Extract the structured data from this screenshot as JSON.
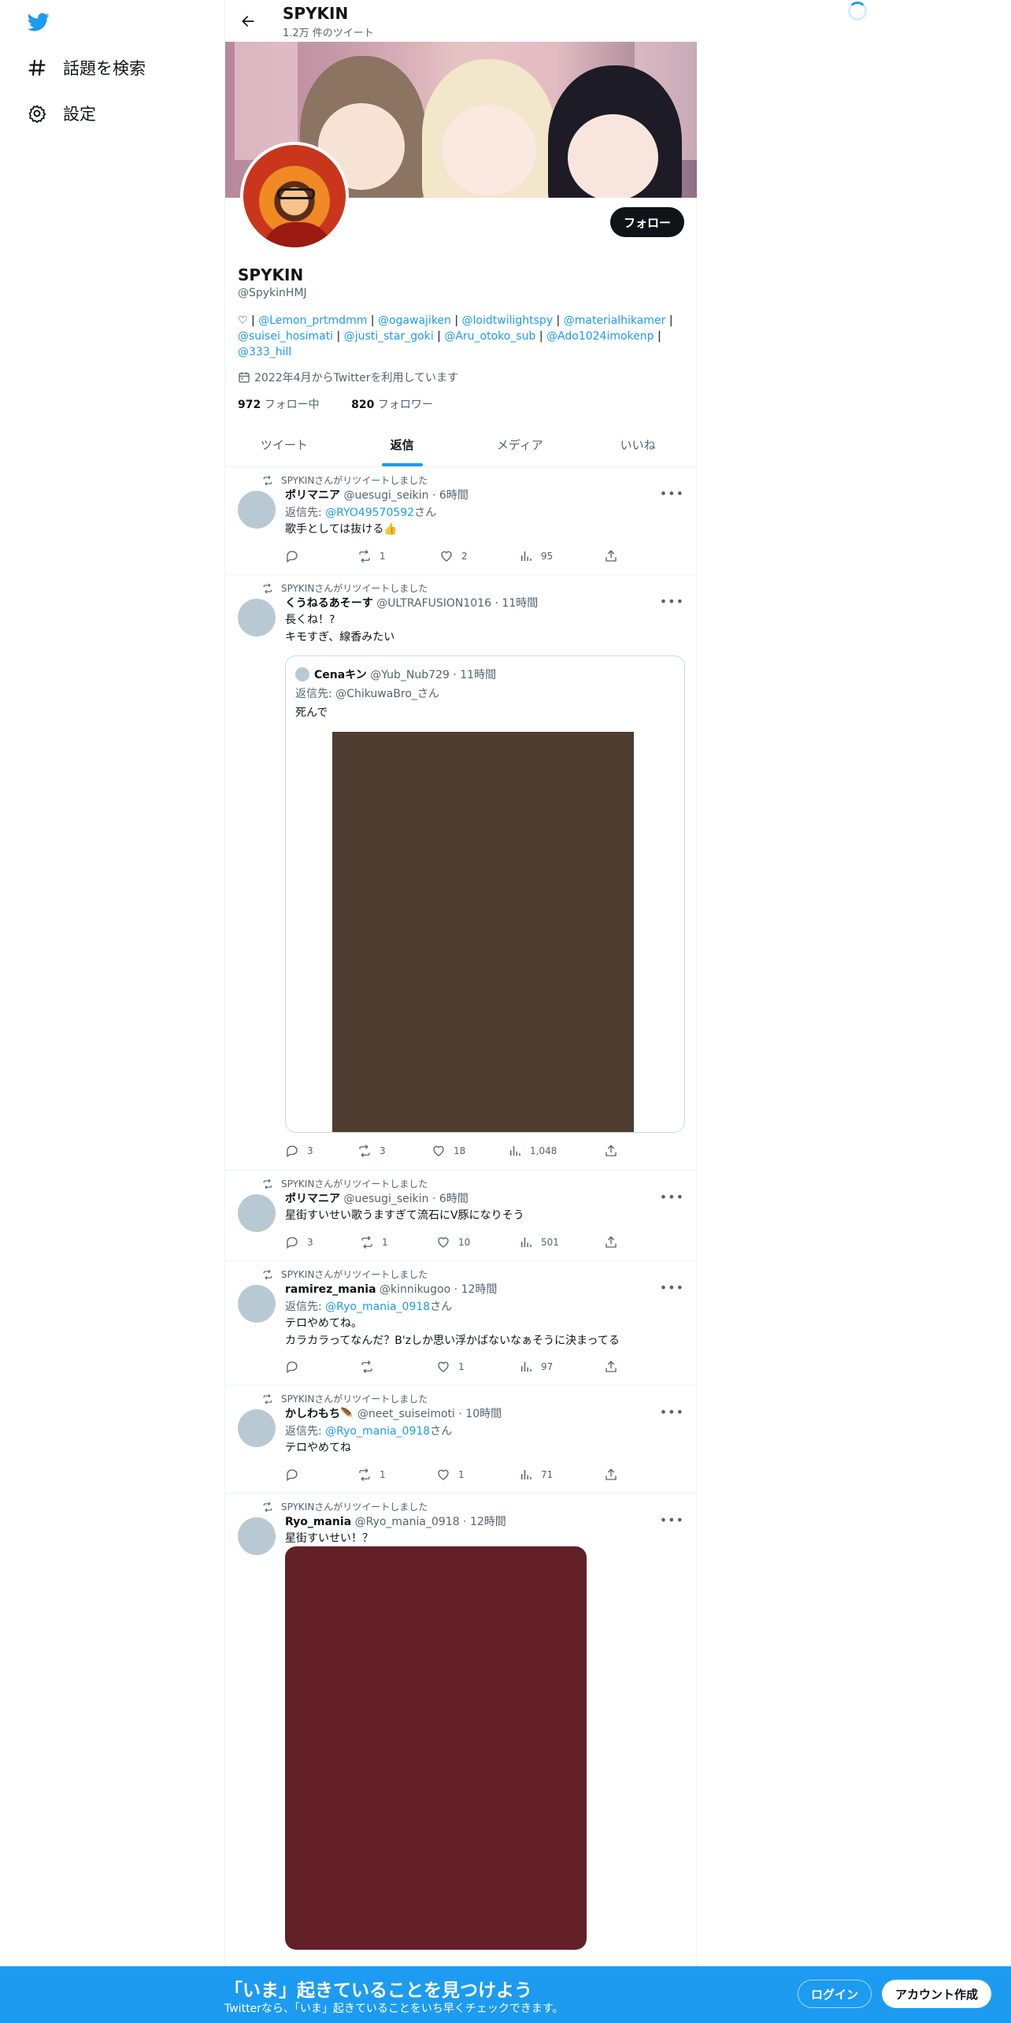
{
  "nav": {
    "explore_label": "話題を検索",
    "settings_label": "設定"
  },
  "header": {
    "title": "SPYKIN",
    "subtitle": "1.2万 件のツイート"
  },
  "profile": {
    "follow_label": "フォロー",
    "name": "SPYKIN",
    "handle": "@SpykinHMJ",
    "bio_prefix": "♡ | ",
    "bio_mentions": [
      "@Lemon_prtmdmm",
      "@ogawajiken",
      "@loidtwilightspy",
      "@materialhikamer",
      "@suisei_hosimati",
      "@justi_star_goki",
      "@Aru_otoko_sub",
      "@Ado1024imokenp",
      "@333_hill"
    ],
    "joined": "2022年4月からTwitterを利用しています",
    "following_count": "972",
    "following_label": "フォロー中",
    "followers_count": "820",
    "followers_label": "フォロワー"
  },
  "tabs": [
    "ツイート",
    "返信",
    "メディア",
    "いいね"
  ],
  "active_tab": "返信",
  "retweet_label": "SPYKINさんがリツイートしました",
  "tweets": [
    {
      "name": "ポリマニア",
      "handle": "@uesugi_seikin",
      "time": "6時間",
      "reply_prefix": "返信先: ",
      "reply_to": "@RYO49570592",
      "reply_suffix": "さん",
      "text": "歌手としては抜ける👍",
      "replies": "",
      "retweets": "1",
      "likes": "2",
      "views": "95"
    },
    {
      "name": "くうねるあそーす",
      "handle": "@ULTRAFUSION1016",
      "time": "11時間",
      "text1": "長くね！?",
      "text2": "キモすぎ、線香みたい",
      "quote": {
        "name": "Cenaキン",
        "handle": "@Yub_Nub729",
        "time": "11時間",
        "reply": "返信先: @ChikuwaBro_さん",
        "text": "死んで"
      },
      "replies": "3",
      "retweets": "3",
      "likes": "18",
      "views": "1,048"
    },
    {
      "name": "ポリマニア",
      "handle": "@uesugi_seikin",
      "time": "6時間",
      "text": "星街すいせい歌うますぎて流石にV豚になりそう",
      "replies": "3",
      "retweets": "1",
      "likes": "10",
      "views": "501"
    },
    {
      "name": "ramirez_mania",
      "handle": "@kinnikugoo",
      "time": "12時間",
      "reply_prefix": "返信先: ",
      "reply_to": "@Ryo_mania_0918",
      "reply_suffix": "さん",
      "text1": "テロやめてね。",
      "text2": "カラカラってなんだ？B'zしか思い浮かばないなぁそうに決まってる",
      "replies": "",
      "retweets": "",
      "likes": "1",
      "views": "97"
    },
    {
      "name": "かしわもち🪶",
      "handle": "@neet_suiseimoti",
      "time": "10時間",
      "reply_prefix": "返信先: ",
      "reply_to": "@Ryo_mania_0918",
      "reply_suffix": "さん",
      "text": "テロやめてね",
      "replies": "",
      "retweets": "1",
      "likes": "1",
      "views": "71"
    },
    {
      "name": "Ryo_mania",
      "handle": "@Ryo_mania_0918",
      "time": "12時間",
      "text": "星街すいせい！？"
    }
  ],
  "bottom_bar": {
    "title": "「いま」起きていることを見つけよう",
    "subtitle": "Twitterなら、「いま」起きていることをいち早くチェックできます。",
    "login_label": "ログイン",
    "signup_label": "アカウント作成"
  },
  "colors": {
    "accent": "#1d9bf0",
    "text": "#0f1419",
    "muted": "#536471"
  }
}
